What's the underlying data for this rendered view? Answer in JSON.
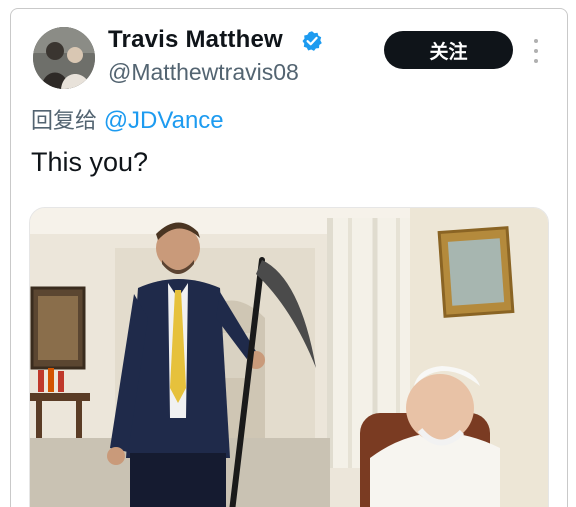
{
  "tweet": {
    "author": {
      "display_name": "Travis Matthew",
      "handle": "@Matthewtravis08",
      "verified": true,
      "avatar_icon": "profile-photo"
    },
    "follow_label": "关注",
    "more_icon": "more-options-icon",
    "reply": {
      "prefix": "回复给",
      "handle": "@JDVance"
    },
    "text": "This you?",
    "media": {
      "type": "photo"
    }
  },
  "colors": {
    "text_primary": "#0f1419",
    "text_secondary": "#536471",
    "link_blue": "#1d9bf0",
    "follow_button_bg": "#0f1419",
    "verified_badge": "#1d9bf0"
  }
}
